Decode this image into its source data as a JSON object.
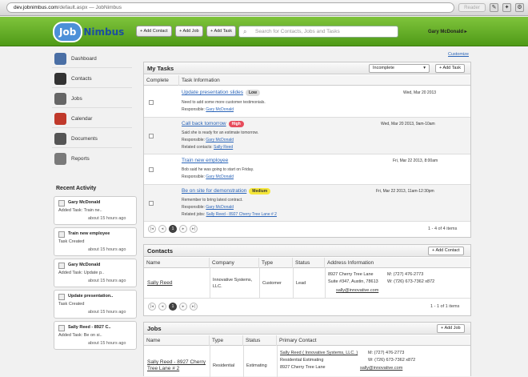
{
  "browser": {
    "url_host": "dev.jobnimbus.com",
    "url_path": "/default.aspx",
    "url_title": "— JobNimbus",
    "reader": "Reader"
  },
  "app": {
    "logo_job": "Job",
    "logo_nimbus": "Nimbus",
    "user_name": "Gary McDonald",
    "customize": "Customize"
  },
  "header": {
    "buttons": [
      "Add Contact",
      "Add Job",
      "Add Task"
    ],
    "search_placeholder": "Search for Contacts, Jobs and Tasks"
  },
  "sidebar": {
    "items": [
      {
        "label": "Dashboard",
        "icon": "dashboard-icon",
        "color": "#4a6fa5"
      },
      {
        "label": "Contacts",
        "icon": "contacts-icon",
        "color": "#333333"
      },
      {
        "label": "Jobs",
        "icon": "jobs-icon",
        "color": "#666666"
      },
      {
        "label": "Calendar",
        "icon": "calendar-icon",
        "color": "#c0392b"
      },
      {
        "label": "Documents",
        "icon": "documents-icon",
        "color": "#555555"
      },
      {
        "label": "Reports",
        "icon": "reports-icon",
        "color": "#7a7a7a"
      }
    ],
    "recent_title": "Recent Activity",
    "activity": [
      {
        "name": "Gary McDonald",
        "action": "Added Task: Train ne..",
        "time": "about 15 hours ago"
      },
      {
        "name": "Train new employee",
        "action": "Task Created",
        "time": "about 15 hours ago"
      },
      {
        "name": "Gary McDonald",
        "action": "Added Task: Update p..",
        "time": "about 15 hours ago"
      },
      {
        "name": "Update presentation..",
        "action": "Task Created",
        "time": "about 15 hours ago"
      },
      {
        "name": "Sally Reed - 8927 C..",
        "action": "Added Task: Be on si..",
        "time": "about 15 hours ago"
      }
    ]
  },
  "tasks": {
    "title": "My Tasks",
    "filter": "Incomplete",
    "add_label": "Add Task",
    "col_complete": "Complete",
    "col_info": "Task Information",
    "rows": [
      {
        "title": "Update presentation slides",
        "badge": "Low",
        "badge_color": "#dddddd",
        "date": "Wed, Mar 20 2013",
        "desc": "Need to add some more customer testimonials.",
        "resp_label": "Responsible:",
        "resp": "Gary McDonald",
        "extra_label": "",
        "extra": ""
      },
      {
        "title": "Call back tomorrow",
        "badge": "High",
        "badge_color": "#e74c5c",
        "date": "Wed, Mar 20 2013, 9am-10am",
        "desc": "Said she is ready for an estimate tomorrow.",
        "resp_label": "Responsible:",
        "resp": "Gary McDonald",
        "extra_label": "Related contacts:",
        "extra": "Sally Reed"
      },
      {
        "title": "Train new employee",
        "badge": "",
        "badge_color": "",
        "date": "Fri, Mar 22 2013, 8:00am",
        "desc": "Bob said he was going to start on Friday.",
        "resp_label": "Responsible:",
        "resp": "Gary McDonald",
        "extra_label": "",
        "extra": ""
      },
      {
        "title": "Be on site for demonstration",
        "badge": "Medium",
        "badge_color": "#f5e63a",
        "date": "Fri, Mar 22 2013, 11am-12:30pm",
        "desc": "Remember to bring latest contract.",
        "resp_label": "Responsible:",
        "resp": "Gary McDonald",
        "extra_label": "Related jobs:",
        "extra": "Sally Reed - 8927 Cherry Tree Lane # 2"
      }
    ],
    "page": "1",
    "page_info": "1 - 4 of 4 items"
  },
  "contacts": {
    "title": "Contacts",
    "add_label": "Add Contact",
    "columns": [
      "Name",
      "Company",
      "Type",
      "Status",
      "Address Information"
    ],
    "row": {
      "name": "Sally Reed",
      "company": "Innovative Systems, LLC.",
      "type": "Customer",
      "status": "Lead",
      "addr1": "8927 Cherry Tree Lane",
      "addr2": "Suite #347, Austin, 78613",
      "email": "sally@innovative.com",
      "phone_m": "M: (727) 476-2773",
      "phone_w": "W: (726) 673-7362 x872"
    },
    "page": "1",
    "page_info": "1 - 1 of 1 items"
  },
  "jobs": {
    "title": "Jobs",
    "add_label": "Add Job",
    "columns": [
      "Name",
      "Type",
      "Status",
      "Primary Contact"
    ],
    "row": {
      "name": "Sally Reed - 8927 Cherry Tree Lane # 2",
      "type": "Residential",
      "status": "Estimating",
      "contact": "Sally Reed ( Innovative Systems, LLC. )",
      "ctype": "Residential Estimating",
      "addr": "8927 Cherry Tree Lane",
      "phone_m": "M: (727) 476-2773",
      "phone_w": "W: (726) 673-7362 x872",
      "email": "sally@innovative.com"
    }
  },
  "colors": {
    "header_green": "#5faa22",
    "link_blue": "#2a64b8"
  }
}
